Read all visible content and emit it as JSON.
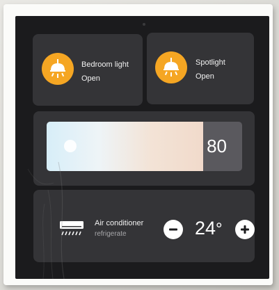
{
  "lights": [
    {
      "name": "Bedroom light",
      "status": "Open",
      "icon": "pendant-lamp-icon"
    },
    {
      "name": "Spotlight",
      "status": "Open",
      "icon": "pendant-lamp-icon"
    }
  ],
  "dimmer": {
    "value": "80",
    "level_percent": 80,
    "gradient_colors": [
      "#d7eef8",
      "#eef4f7",
      "#f3e3d6",
      "#f1dacb"
    ]
  },
  "air_conditioner": {
    "name": "Air conditioner",
    "mode": "refrigerate",
    "temperature": "24",
    "unit": "°",
    "icon": "air-conditioner-icon",
    "decrease_icon": "minus-icon",
    "increase_icon": "plus-icon"
  },
  "colors": {
    "accent": "#f5a623",
    "card": "#343437",
    "screen": "#1b1b1d"
  }
}
